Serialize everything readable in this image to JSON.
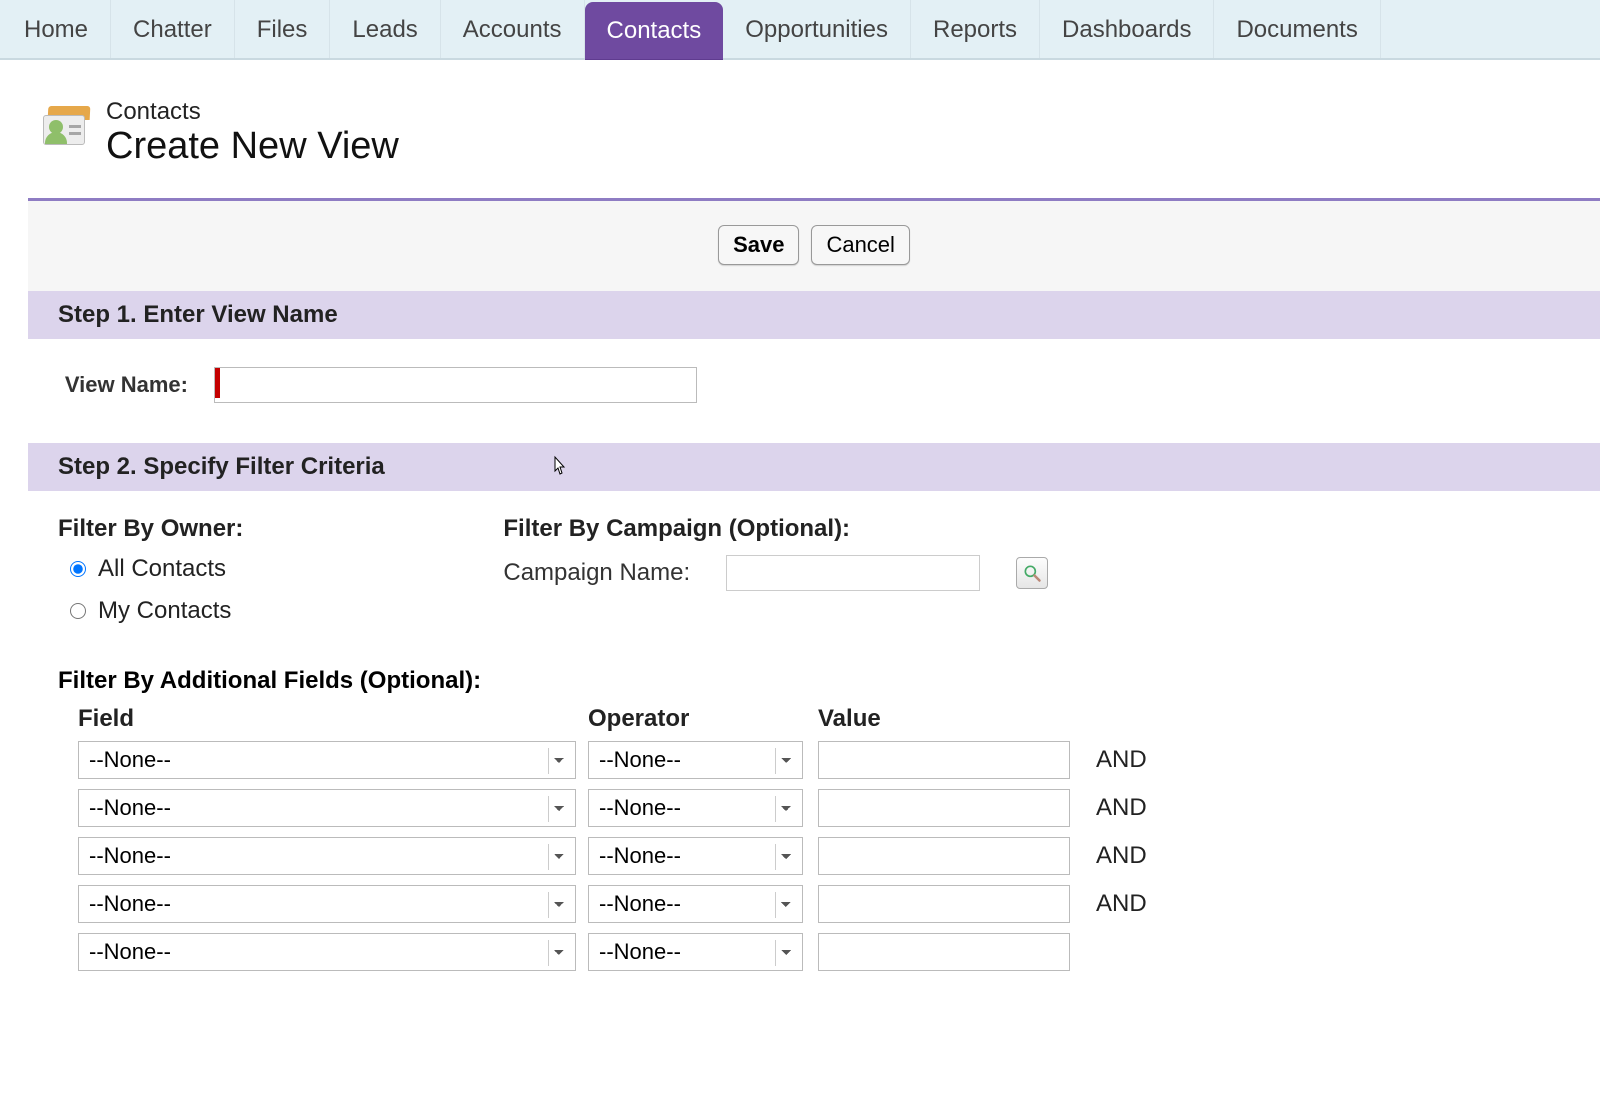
{
  "tabs": [
    {
      "label": "Home",
      "active": false
    },
    {
      "label": "Chatter",
      "active": false
    },
    {
      "label": "Files",
      "active": false
    },
    {
      "label": "Leads",
      "active": false
    },
    {
      "label": "Accounts",
      "active": false
    },
    {
      "label": "Contacts",
      "active": true
    },
    {
      "label": "Opportunities",
      "active": false
    },
    {
      "label": "Reports",
      "active": false
    },
    {
      "label": "Dashboards",
      "active": false
    },
    {
      "label": "Documents",
      "active": false
    }
  ],
  "header": {
    "entity": "Contacts",
    "title": "Create New View"
  },
  "buttons": {
    "save": "Save",
    "cancel": "Cancel"
  },
  "step1": {
    "heading": "Step 1. Enter View Name",
    "view_name_label": "View Name:",
    "view_name_value": ""
  },
  "step2": {
    "heading": "Step 2. Specify Filter Criteria",
    "filter_by_owner_label": "Filter By Owner:",
    "owner_options": [
      {
        "label": "All Contacts",
        "checked": true
      },
      {
        "label": "My Contacts",
        "checked": false
      }
    ],
    "filter_by_campaign_label": "Filter By Campaign (Optional):",
    "campaign_name_label": "Campaign Name:",
    "campaign_name_value": "",
    "filter_additional_label": "Filter By Additional Fields (Optional):",
    "columns": {
      "field": "Field",
      "operator": "Operator",
      "value": "Value"
    },
    "none_option": "--None--",
    "and_label": "AND",
    "rows": [
      {
        "field": "--None--",
        "operator": "--None--",
        "value": ""
      },
      {
        "field": "--None--",
        "operator": "--None--",
        "value": ""
      },
      {
        "field": "--None--",
        "operator": "--None--",
        "value": ""
      },
      {
        "field": "--None--",
        "operator": "--None--",
        "value": ""
      },
      {
        "field": "--None--",
        "operator": "--None--",
        "value": ""
      }
    ]
  }
}
